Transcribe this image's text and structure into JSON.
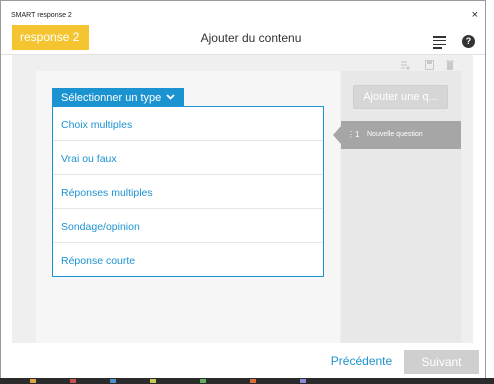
{
  "window": {
    "title": "SMART response 2",
    "close_glyph": "×"
  },
  "header": {
    "brand": "response 2",
    "title": "Ajouter du contenu",
    "menu_icon": "menu-lines-icon",
    "help_glyph": "?"
  },
  "toolbar": {
    "icons": [
      "add-list-icon",
      "save-icon",
      "delete-icon"
    ]
  },
  "dropdown": {
    "label": "Sélectionner un type",
    "items": [
      "Choix multiples",
      "Vrai ou faux",
      "Réponses multiples",
      "Sondage/opinion",
      "Réponse courte"
    ]
  },
  "right_panel": {
    "add_button": "Ajouter une q...",
    "questions": [
      {
        "number": "1",
        "label": "Nouvelle question",
        "grip": "⋮"
      }
    ]
  },
  "footer": {
    "prev": "Précédente",
    "next": "Suivant"
  },
  "colors": {
    "brand": "#f4c531",
    "accent": "#1c93d1",
    "disabled": "#cfcfcf",
    "selected_item": "#a6a6a6"
  }
}
